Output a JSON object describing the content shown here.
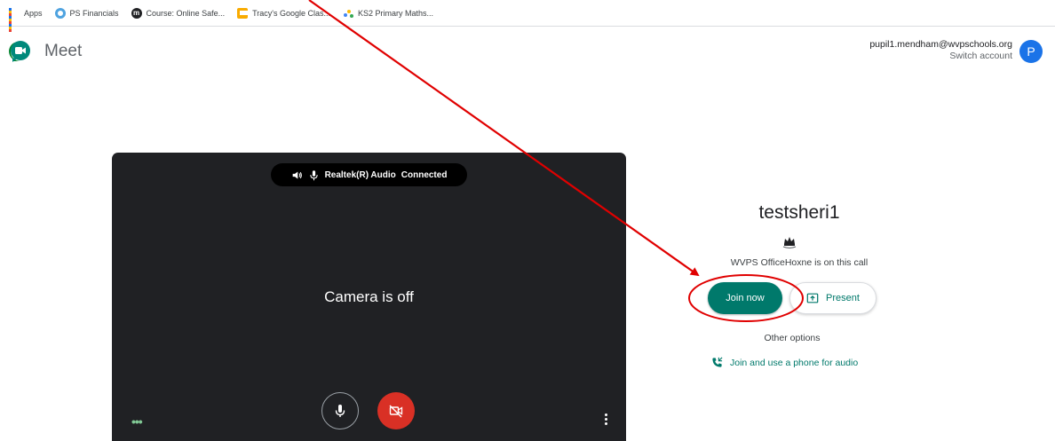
{
  "bookmarks": [
    {
      "label": "Apps",
      "icon": "apps-grid-icon"
    },
    {
      "label": "PS Financials",
      "icon": "ps-financials-icon"
    },
    {
      "label": "Course: Online Safe...",
      "icon": "course-icon"
    },
    {
      "label": "Tracy's Google Clas...",
      "icon": "google-classroom-icon"
    },
    {
      "label": "KS2 Primary Maths...",
      "icon": "ks2-maths-icon"
    }
  ],
  "header": {
    "app_name": "Meet",
    "account_email": "pupil1.mendham@wvpschools.org",
    "switch_account": "Switch account",
    "avatar_letter": "P"
  },
  "video": {
    "audio_device": "Realtek(R) Audio",
    "audio_status": "Connected",
    "camera_status": "Camera is off"
  },
  "meeting": {
    "title": "testsheri1",
    "on_call_text": "WVPS OfficeHoxne is on this call",
    "join_label": "Join now",
    "present_label": "Present",
    "other_options": "Other options",
    "phone_label": "Join and use a phone for audio"
  },
  "colors": {
    "accent": "#00796b",
    "camera_off_button": "#d93025",
    "video_background": "#202124",
    "annotation": "#e00000"
  }
}
